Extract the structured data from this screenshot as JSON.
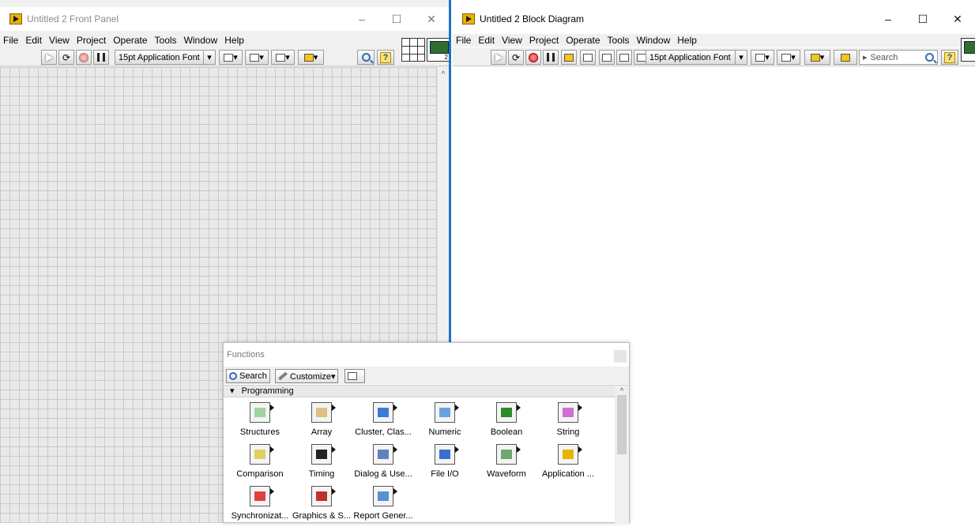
{
  "front_panel": {
    "title": "Untitled 2 Front Panel",
    "menu": [
      "File",
      "Edit",
      "View",
      "Project",
      "Operate",
      "Tools",
      "Window",
      "Help"
    ],
    "font_select": "15pt Application Font",
    "icon_number": "2"
  },
  "block_diagram": {
    "title": "Untitled 2 Block Diagram",
    "menu": [
      "File",
      "Edit",
      "View",
      "Project",
      "Operate",
      "Tools",
      "Window",
      "Help"
    ],
    "font_select": "15pt Application Font",
    "search_placeholder": "Search"
  },
  "window_controls": {
    "minimize": "–",
    "maximize": "☐",
    "close": "✕"
  },
  "palette": {
    "title": "Functions",
    "search_label": "Search",
    "customize_label": "Customize▾",
    "category": "Programming",
    "items": [
      {
        "label": "Structures",
        "icon": "structures-icon",
        "color": "#9fd39f"
      },
      {
        "label": "Array",
        "icon": "array-icon",
        "color": "#e0c080"
      },
      {
        "label": "Cluster, Clas...",
        "icon": "cluster-icon",
        "color": "#3a7bd5"
      },
      {
        "label": "Numeric",
        "icon": "numeric-icon",
        "color": "#6aa0e0"
      },
      {
        "label": "Boolean",
        "icon": "boolean-icon",
        "color": "#2e8b2e"
      },
      {
        "label": "String",
        "icon": "string-icon",
        "color": "#d070d0"
      },
      {
        "label": "Comparison",
        "icon": "comparison-icon",
        "color": "#e0d060"
      },
      {
        "label": "Timing",
        "icon": "timing-icon",
        "color": "#222222"
      },
      {
        "label": "Dialog & Use...",
        "icon": "dialog-icon",
        "color": "#6080c0"
      },
      {
        "label": "File I/O",
        "icon": "file-io-icon",
        "color": "#3a6fd0"
      },
      {
        "label": "Waveform",
        "icon": "waveform-icon",
        "color": "#6fa86f"
      },
      {
        "label": "Application ...",
        "icon": "application-control-icon",
        "color": "#e8b400"
      },
      {
        "label": "Synchronizat...",
        "icon": "synchronization-icon",
        "color": "#e04040"
      },
      {
        "label": "Graphics & S...",
        "icon": "graphics-sound-icon",
        "color": "#c03030"
      },
      {
        "label": "Report Gener...",
        "icon": "report-generation-icon",
        "color": "#5a8fd0"
      }
    ]
  }
}
